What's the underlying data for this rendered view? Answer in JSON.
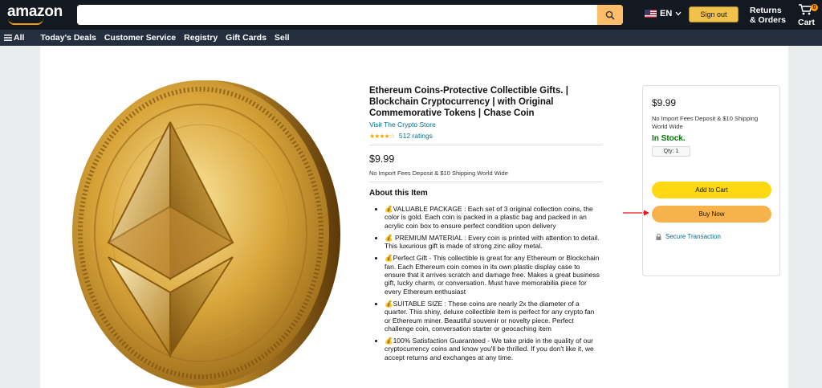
{
  "header": {
    "logo": "amazon",
    "search_placeholder": "",
    "search_icon": "search-icon",
    "language": "EN",
    "signout_label": "Sign out",
    "returns_line1": "Returns",
    "returns_line2": "& Orders",
    "cart_label": "Cart",
    "cart_count": "0"
  },
  "subnav": {
    "all": "All",
    "items": [
      "Today's Deals",
      "Customer Service",
      "Registry",
      "Gift Cards",
      "Sell"
    ]
  },
  "product": {
    "title": "Ethereum Coins-Protective Collectible Gifts. | Blockchain Cryptocurrency | with Original Commemorative Tokens | Chase Coin",
    "store": "Visit The Crypto Store",
    "stars": "★★★★☆",
    "rating_count": "512 ratings",
    "price": "$9.99",
    "fees": "No Import Fees Deposit & $10 Shipping World Wide",
    "about_heading": "About this Item",
    "bullets": [
      "💰VALUABLE PACKAGE : Each set of 3 original collection coins, the color is gold. Each coin is packed in a plastic bag and packed in an acrylic coin box to ensure perfect condition upon delivery",
      "💰 PREMIUM MATERIAL : Every coin is printed with attention to detail. This luxurious gift is made of strong zinc alloy metal.",
      "💰Perfect Gift - This collectible is great for any Ethereum or Blockchain fan. Each Ethereum coin comes in its own plastic display case to ensure that it arrives scratch and damage free. Makes a great business gift, lucky charm, or conversation. Must have memorabilia piece for every Ethereum enthusiast",
      "💰SUITABLE SIZE : These coins are nearly 2x the diameter of a quarter. This shiny, deluxe collectible item is perfect for any crypto fan or Ethereum miner. Beautiful souvenir or novelty piece. Perfect challenge coin, conversation starter or geocaching item",
      "💰100% Satisfaction Guaranteed - We take pride in the quality of our cryptocurrency coins and know you'll be thrilled. If you don't like it, we accept returns and exchanges at any time."
    ]
  },
  "buybox": {
    "price": "$9.99",
    "fees": "No Import Fees Deposit & $10 Shipping World Wide",
    "stock": "In Stock.",
    "qty": "Qty: 1",
    "add_to_cart": "Add to Cart",
    "buy_now": "Buy Now",
    "secure": "Secure Transaction"
  },
  "colors": {
    "nav": "#131921",
    "subnav": "#232f3e",
    "add_to_cart": "#ffd814",
    "buy_now": "#f7b24b",
    "link": "#007185",
    "stock": "#007600"
  }
}
